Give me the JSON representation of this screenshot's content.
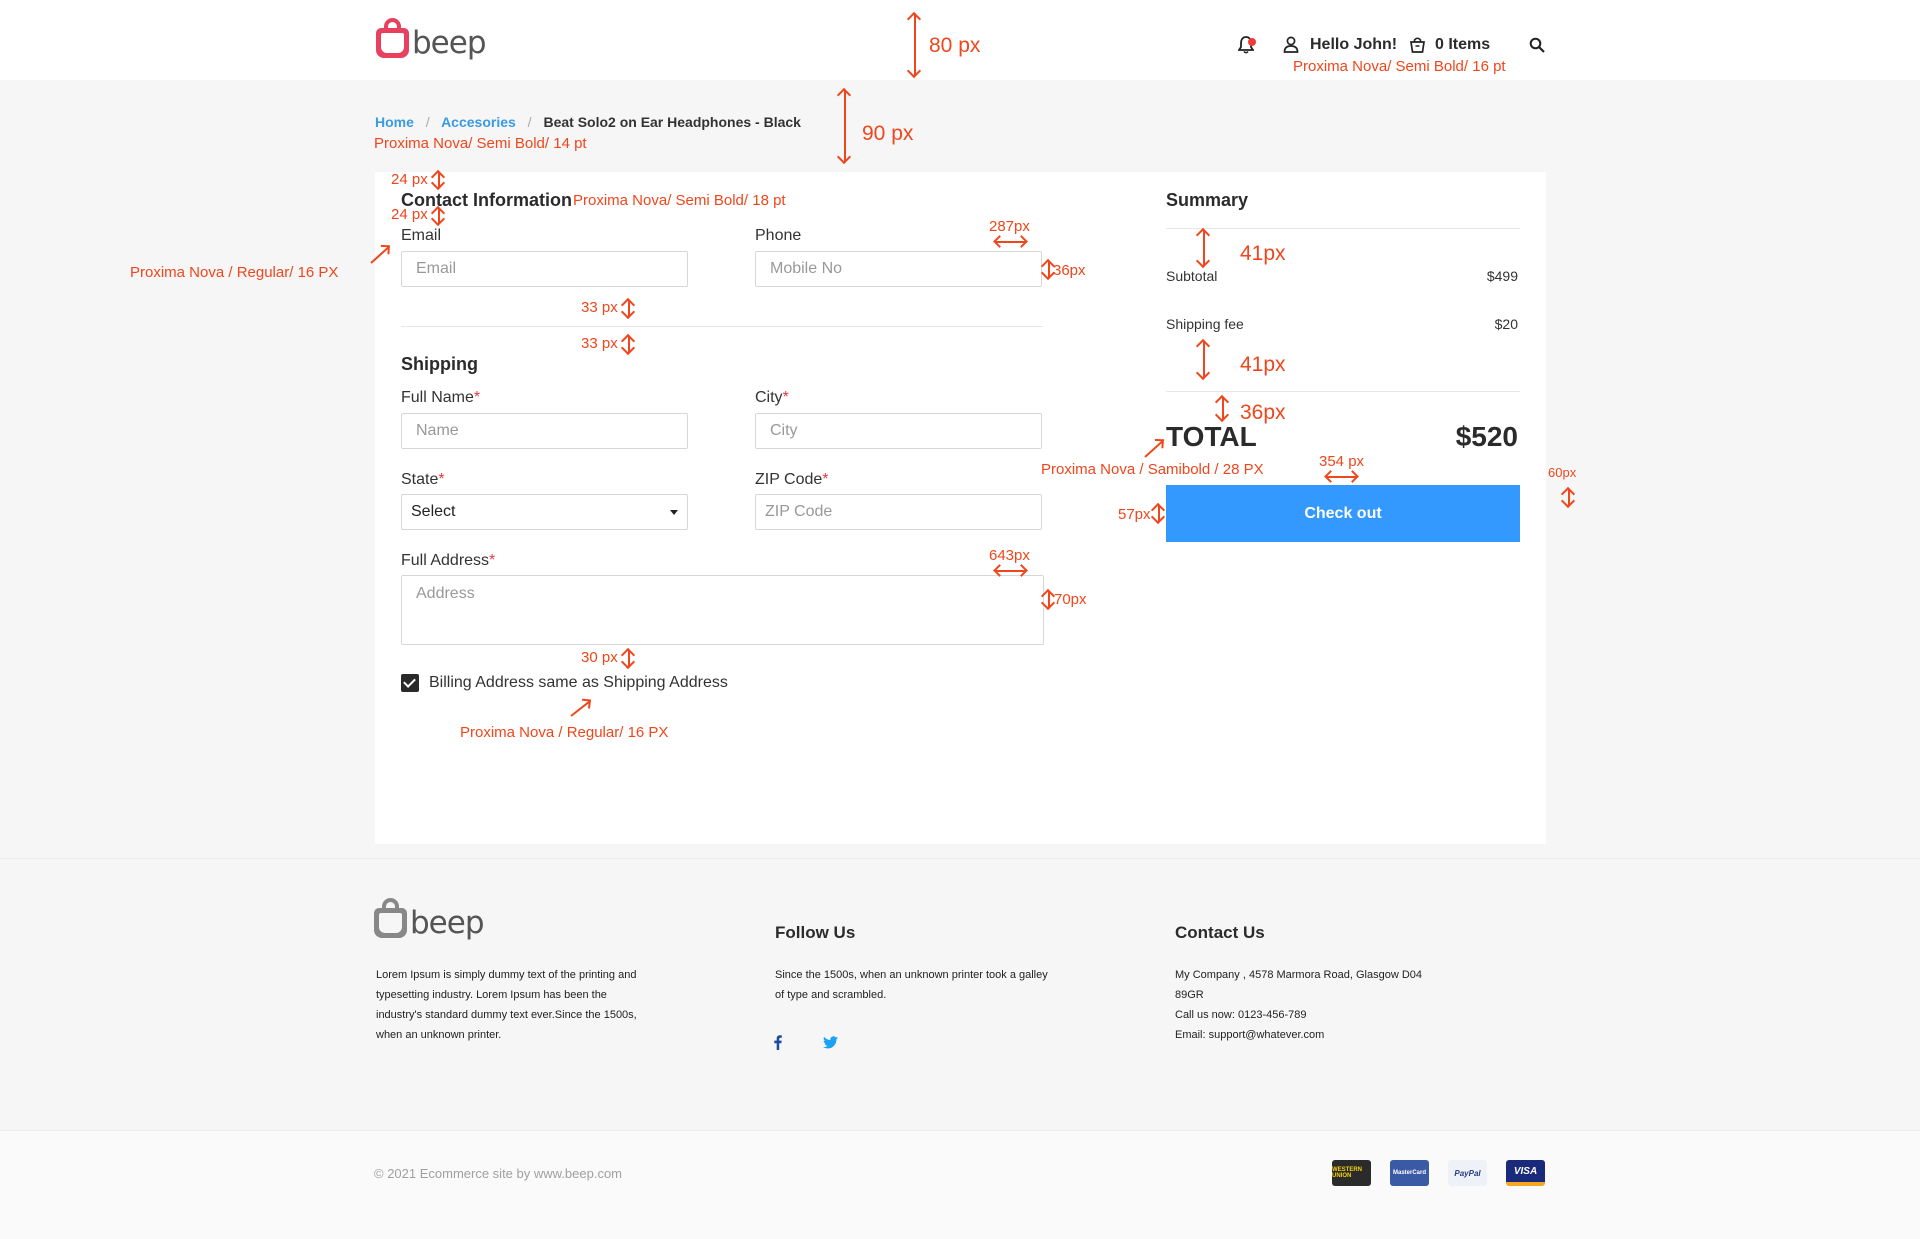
{
  "header": {
    "logo_text": "beep",
    "greeting": "Hello John!",
    "cart": "0 Items",
    "icons": [
      "bell-icon",
      "user-icon",
      "cart-icon",
      "search-icon"
    ]
  },
  "breadcrumb": {
    "items": [
      "Home",
      "Accesories",
      "Beat Solo2 on Ear Headphones - Black"
    ],
    "separator": "/"
  },
  "contact": {
    "title": "Contact Information",
    "email_label": "Email",
    "email_placeholder": "Email",
    "phone_label": "Phone",
    "phone_placeholder": "Mobile No"
  },
  "shipping": {
    "title": "Shipping",
    "fullname_label": "Full Name",
    "fullname_placeholder": "Name",
    "city_label": "City",
    "city_placeholder": "City",
    "state_label": "State",
    "state_value": "Select",
    "zip_label": "ZIP Code",
    "zip_placeholder": "ZIP Code",
    "address_label": "Full Address",
    "address_placeholder": "Address",
    "required_mark": "*",
    "billing_same": "Billing Address same as Shipping Address",
    "billing_checked": true
  },
  "summary": {
    "title": "Summary",
    "subtotal_label": "Subtotal",
    "subtotal_value": "$499",
    "shipping_label": "Shipping fee",
    "shipping_value": "$20",
    "total_label": "TOTAL",
    "total_value": "$520",
    "checkout_label": "Check out"
  },
  "annotations": {
    "h80": "80 px",
    "h90": "90 px",
    "header_font": "Proxima Nova/ Semi Bold/ 16 pt",
    "crumb_font": "Proxima Nova/ Semi Bold/ 14 pt",
    "title_font": "Proxima Nova/ Semi Bold/ 18 pt",
    "label_font": "Proxima Nova / Regular/ 16 PX",
    "checkbox_font": "Proxima Nova / Regular/ 16 PX",
    "total_font": "Proxima Nova / Samibold / 28 PX",
    "s24a": "24 px",
    "s24b": "24 px",
    "s33a": "33 px",
    "s33b": "33 px",
    "s30": "30 px",
    "w287": "287px",
    "h36": "36px",
    "w643": "643px",
    "h70": "70px",
    "s41a": "41px",
    "s41b": "41px",
    "s36": "36px",
    "w354": "354 px",
    "h57": "57px",
    "s60": "60px"
  },
  "footer": {
    "logo_text": "beep",
    "about": "Lorem Ipsum is simply dummy text of the printing and typesetting industry. Lorem Ipsum has been the industry's standard dummy text ever.Since the 1500s, when an unknown printer.",
    "follow_title": "Follow Us",
    "follow_text": "Since the 1500s, when an unknown printer took a galley of type and scrambled.",
    "social_icons": [
      "facebook-icon",
      "twitter-icon"
    ],
    "contact_title": "Contact Us",
    "contact_address": "My Company , 4578 Marmora Road, Glasgow D04 89GR",
    "contact_phone": "Call us now: 0123-456-789",
    "contact_email": "Email: support@whatever.com",
    "copyright": "© 2021 Ecommerce site by www.beep.com",
    "payments": [
      {
        "name": "WESTERN UNION",
        "bg": "#2b2b2b",
        "fg": "#f5d20a"
      },
      {
        "name": "MasterCard",
        "bg": "#3b5aa6",
        "fg": "#ffffff"
      },
      {
        "name": "PayPal",
        "bg": "#eef1f7",
        "fg": "#253b80"
      },
      {
        "name": "VISA",
        "bg": "#1a2a7a",
        "fg": "#ffffff"
      }
    ]
  },
  "colors": {
    "accent": "#3399ff",
    "link": "#3a9be0",
    "annotation": "#f0461c",
    "logo_brand": "#e8415f",
    "logo_footer": "#888888"
  }
}
